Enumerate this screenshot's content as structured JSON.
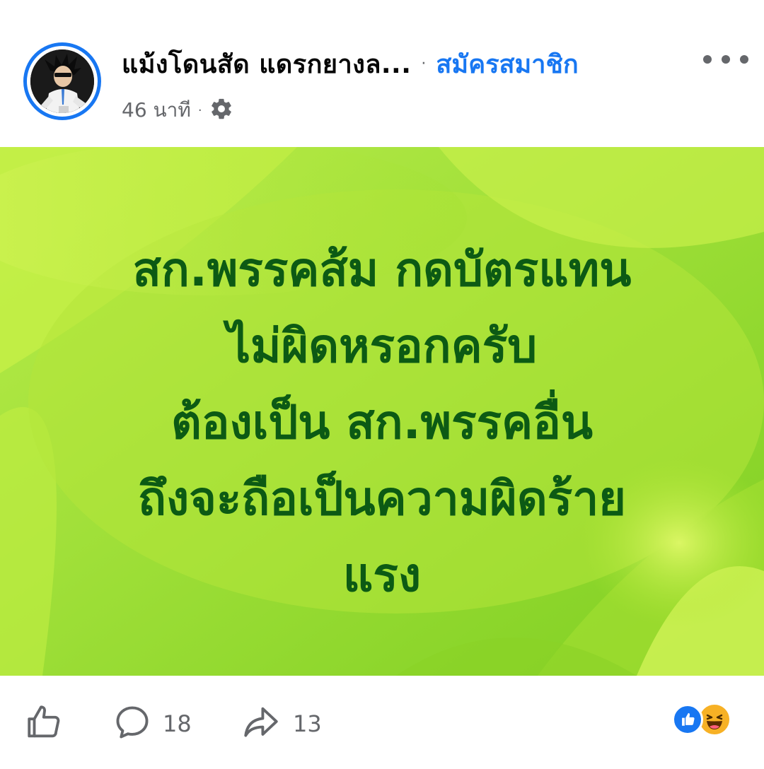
{
  "post": {
    "author": "แม้งโดนสัด แดรกยางล...",
    "separator": "·",
    "join_label": "สมัครสมาชิก",
    "timestamp": "46 นาที",
    "meta_separator": "·",
    "privacy_icon": "gear-icon",
    "more_icon": "more-horizontal-icon",
    "avatar_ring_color": "#1877f2"
  },
  "media": {
    "lines": [
      "สก.พรรคส้ม กดบัตรแทน",
      "ไม่ผิดหรอกครับ",
      "ต้องเป็น สก.พรรคอื่น",
      "ถึงจะถือเป็นความผิดร้าย",
      "แรง"
    ],
    "text_color": "#0c5a14",
    "background_color": "#a6e22c"
  },
  "actions": {
    "like_icon": "thumbs-up-icon",
    "comment_icon": "comment-icon",
    "comment_count": "18",
    "share_icon": "share-icon",
    "share_count": "13",
    "reactions": [
      "like",
      "haha"
    ]
  }
}
